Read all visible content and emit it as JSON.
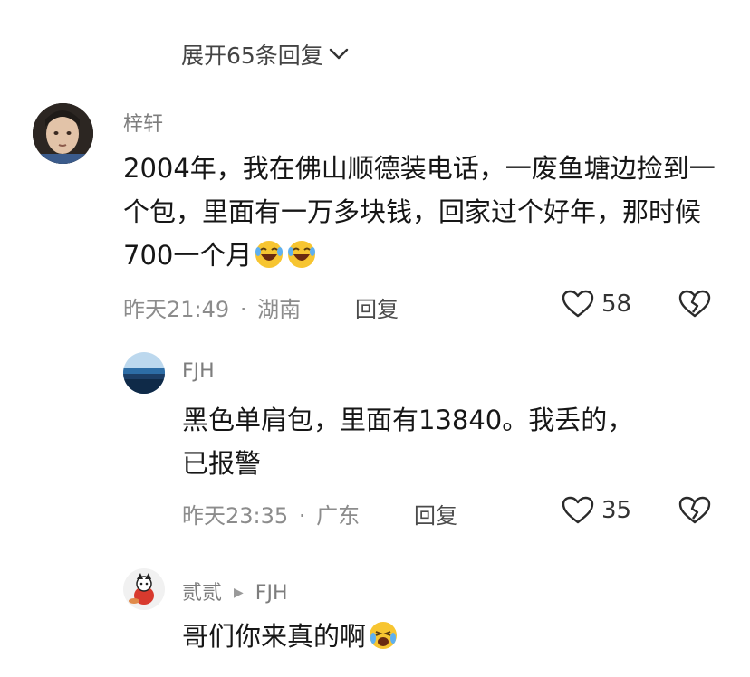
{
  "thread": {
    "expand_label": "展开65条回复"
  },
  "comment_main": {
    "username": "梓轩",
    "text": "2004年，我在佛山顺德装电话，一废鱼塘边捡到一个包，里面有一万多块钱，回家过个好年，那时候700一个月",
    "emoji_count": 2,
    "emoji_name": "laugh-cry-emoji",
    "time": "昨天21:49",
    "location": "湖南",
    "separator": "·",
    "reply_label": "回复",
    "likes": "58"
  },
  "comment_reply1": {
    "username": "FJH",
    "text_line1": "黑色单肩包，里面有13840。我丢的，",
    "text_line2": "已报警",
    "time": "昨天23:35",
    "location": "广东",
    "separator": "·",
    "reply_label": "回复",
    "likes": "35"
  },
  "comment_reply2": {
    "username": "贰贰",
    "reply_to": "FJH",
    "text": "哥们你来真的啊",
    "emoji_name": "laugh-tears-emoji"
  },
  "colors": {
    "heart_stroke": "#2a2a2a",
    "meta_gray": "#8c8c8c",
    "emoji_yellow": "#f7c531"
  }
}
